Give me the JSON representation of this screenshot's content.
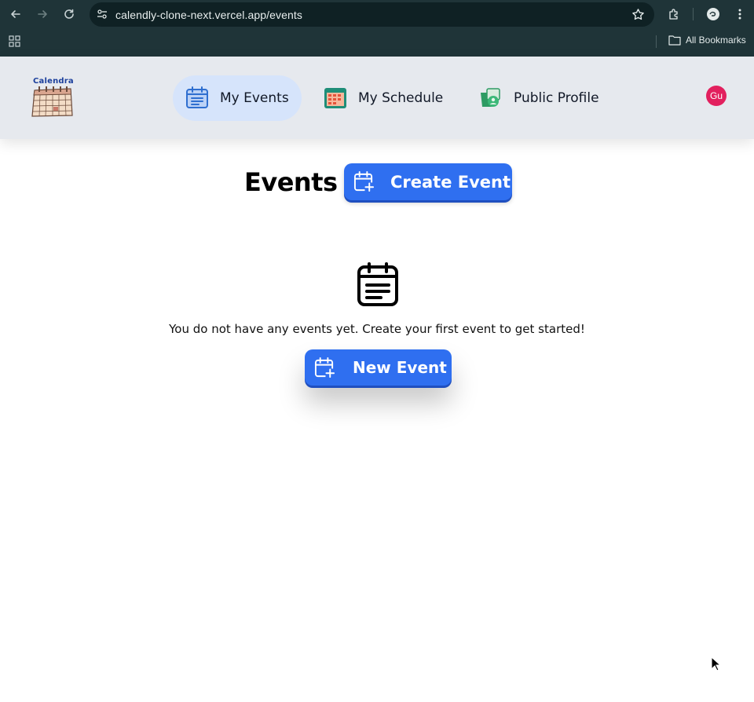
{
  "browser": {
    "url": "calendly-clone-next.vercel.app/events",
    "bookmarks_label": "All Bookmarks"
  },
  "header": {
    "logo_text": "Calendra",
    "nav": [
      {
        "label": "My Events",
        "icon": "calendar-list-icon",
        "active": true
      },
      {
        "label": "My Schedule",
        "icon": "schedule-calendar-icon",
        "active": false
      },
      {
        "label": "Public Profile",
        "icon": "public-profile-icon",
        "active": false
      }
    ],
    "avatar_initials": "Gu"
  },
  "main": {
    "title": "Events",
    "create_button": "Create Event",
    "empty_message": "You do not have any events yet. Create your first event to get started!",
    "new_button": "New Event"
  },
  "colors": {
    "chrome": "#1f3438",
    "header_bg": "#e6e9ee",
    "active_nav": "#d6e4fb",
    "primary": "#2f6ff0",
    "avatar": "#e2205e"
  }
}
